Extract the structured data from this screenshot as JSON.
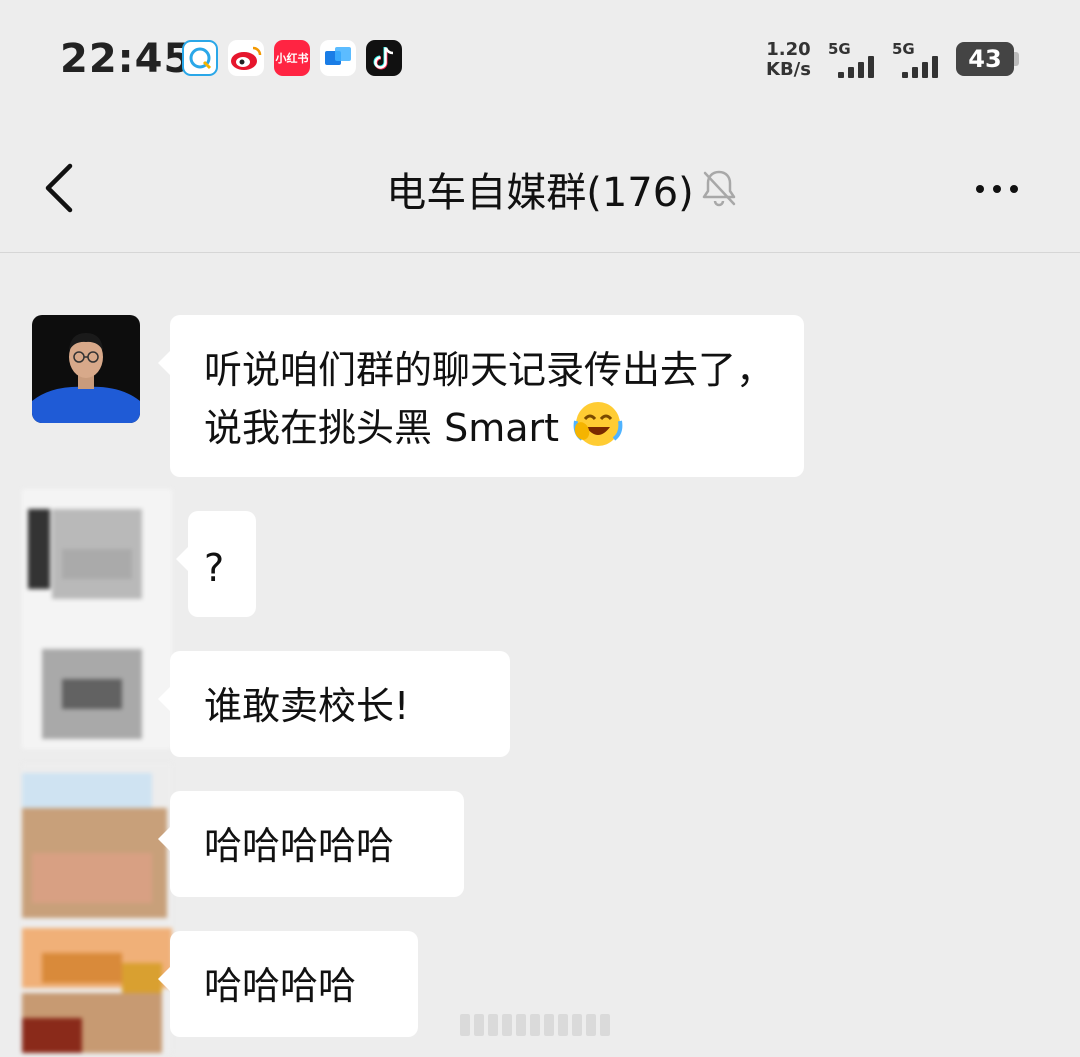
{
  "status_bar": {
    "time": "22:45",
    "app_icons": [
      "qq-browser-icon",
      "weibo-icon",
      "xiaohongshu-icon",
      "cloud-app-icon",
      "douyin-icon"
    ],
    "xiaohongshu_label": "小红书",
    "net_speed_value": "1.20",
    "net_speed_unit": "KB/s",
    "signal_1_label": "5G",
    "signal_2_label": "5G",
    "battery": "43",
    "battery_level": 0.43
  },
  "header": {
    "title": "电车自媒群(176)",
    "back_icon": "chevron-left-icon",
    "mute_icon": "bell-off-icon",
    "more_icon": "more-dots-icon"
  },
  "messages": [
    {
      "text_line1": "听说咱们群的聊天记录传出去了，",
      "text_line2": "说我在挑头黑 Smart",
      "emoji": "laughing-crying-face"
    },
    {
      "text": "?"
    },
    {
      "text": "谁敢卖校长!"
    },
    {
      "text": "哈哈哈哈哈"
    },
    {
      "text": "哈哈哈哈"
    }
  ],
  "colors": {
    "background": "#ededed",
    "bubble": "#ffffff",
    "text": "#111111",
    "xiaohongshu": "#ff2442",
    "avatar_shirt": "#1f5bd6"
  }
}
